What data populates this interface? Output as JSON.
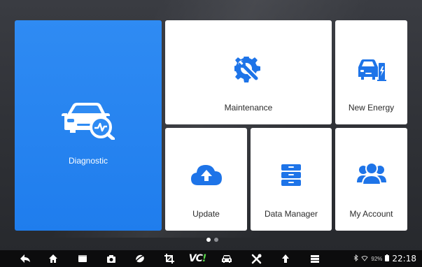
{
  "tiles": {
    "diagnostic": {
      "label": "Diagnostic",
      "icon": "car-diagnostic-icon"
    },
    "maintenance": {
      "label": "Maintenance",
      "icon": "gear-wrench-icon"
    },
    "new_energy": {
      "label": "New Energy",
      "icon": "ev-car-charger-icon"
    },
    "update": {
      "label": "Update",
      "icon": "cloud-upload-icon"
    },
    "data_manager": {
      "label": "Data Manager",
      "icon": "filing-cabinet-icon"
    },
    "my_account": {
      "label": "My Account",
      "icon": "users-icon"
    }
  },
  "pager": {
    "pages": 2,
    "current": 1
  },
  "navbar": {
    "items": [
      "back-icon",
      "home-icon",
      "recent-apps-icon",
      "camera-icon",
      "browser-icon",
      "crop-icon",
      "vci-icon",
      "car-icon",
      "tools-icon",
      "upload-icon",
      "menu-icon"
    ],
    "vci_text": "VC",
    "vci_mark": "!"
  },
  "status": {
    "battery": "92%",
    "time": "22:18"
  },
  "colors": {
    "accent_blue": "#1f7ded",
    "icon_blue": "#1e74e8",
    "vci_green": "#57d34a"
  }
}
